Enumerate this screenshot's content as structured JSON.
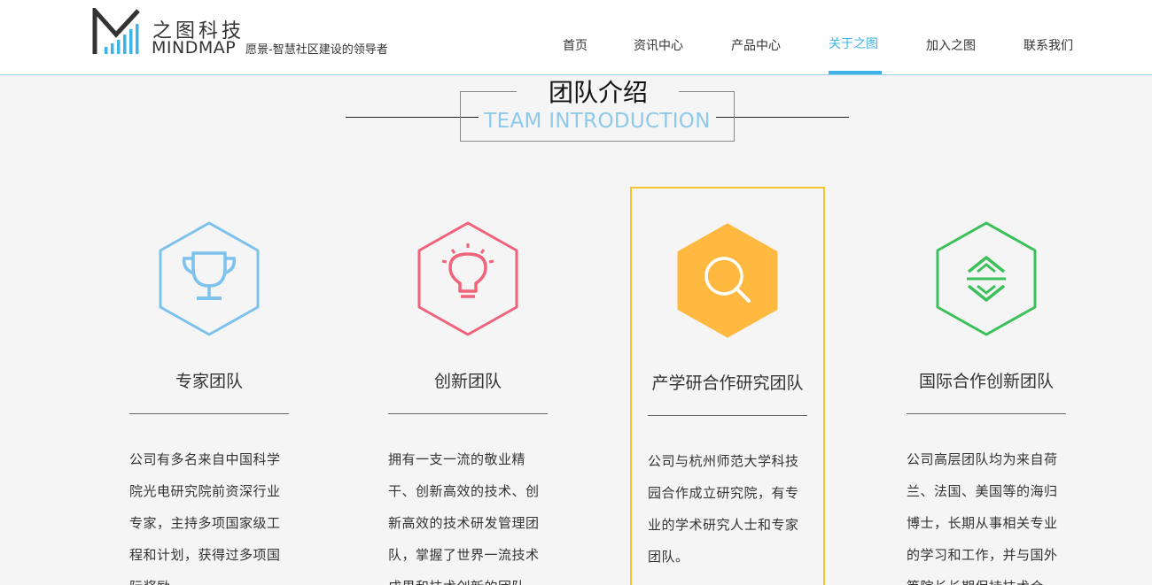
{
  "brand": {
    "name_cn": "之图科技",
    "name_en": "MINDMAP",
    "slogan": "愿景-智慧社区建设的领导者"
  },
  "nav": {
    "items": [
      {
        "label": "首页"
      },
      {
        "label": "资讯中心"
      },
      {
        "label": "产品中心"
      },
      {
        "label": "关于之图",
        "active": true
      },
      {
        "label": "加入之图"
      },
      {
        "label": "联系我们"
      }
    ]
  },
  "section": {
    "title_cn": "团队介绍",
    "title_en": "TEAM INTRODUCTION"
  },
  "cards": [
    {
      "icon": "trophy-icon",
      "color": "#7cc2ec",
      "title": "专家团队",
      "desc": "公司有多名来自中国科学院光电研究院前资深行业专家，主持多项国家级工程和计划，获得过多项国际奖励"
    },
    {
      "icon": "lightbulb-icon",
      "color": "#f0637a",
      "title": "创新团队",
      "desc": "拥有一支一流的敬业精干、创新高效的技术、创新高效的技术研发管理团队，掌握了世界一流技术成果和技术创新的团队"
    },
    {
      "icon": "search-icon",
      "color": "#ffb940",
      "title": "产学研合作研究团队",
      "desc": "公司与杭州师范大学科技园合作成立研究院，有专业的学术研究人士和专家团队。",
      "highlighted": true,
      "highlight_color": "#f6c52d"
    },
    {
      "icon": "exchange-icon",
      "color": "#3cc05a",
      "title": "国际合作创新团队",
      "desc": "公司高层团队均为来自荷兰、法国、美国等的海归博士，长期从事相关专业的学习和工作，并与国外等院长长期保持技术合"
    }
  ],
  "colors": {
    "accent": "#3fb3e6",
    "title_en": "#8ec9ec",
    "background": "#f5f5f5"
  }
}
